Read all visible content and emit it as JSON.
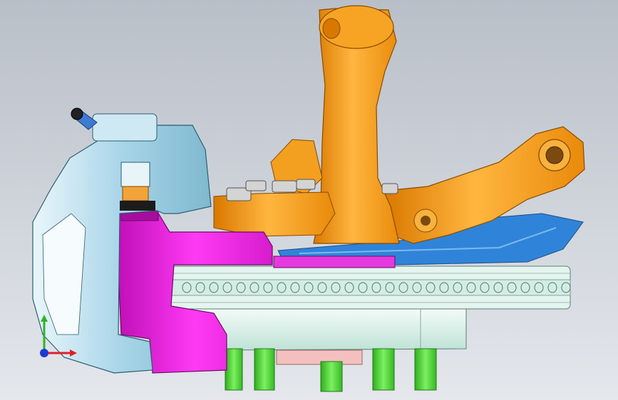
{
  "viewport": {
    "background_top": "#b9bfc8",
    "background_bottom": "#e4e7ec"
  },
  "model": {
    "parts": [
      {
        "name": "brake-caliper",
        "color": "#a9d7ea"
      },
      {
        "name": "knuckle",
        "color": "#e21ad8"
      },
      {
        "name": "brake-disc",
        "color": "#cfe9e0"
      },
      {
        "name": "wheel-hub",
        "color": "#cfece4"
      },
      {
        "name": "wheel-studs",
        "color": "#4bd633"
      },
      {
        "name": "upper-control-arm",
        "color": "#f39a12"
      },
      {
        "name": "lower-control-arm",
        "color": "#f39a12"
      },
      {
        "name": "dust-shield",
        "color": "#2f84d9"
      },
      {
        "name": "brake-line-fitting",
        "color": "#3d7bd3"
      },
      {
        "name": "bolts",
        "color": "#c9c9c9"
      }
    ]
  },
  "triad": {
    "x_color": "#e0202a",
    "y_color": "#2fb32a",
    "z_color": "#1b3bd4"
  }
}
